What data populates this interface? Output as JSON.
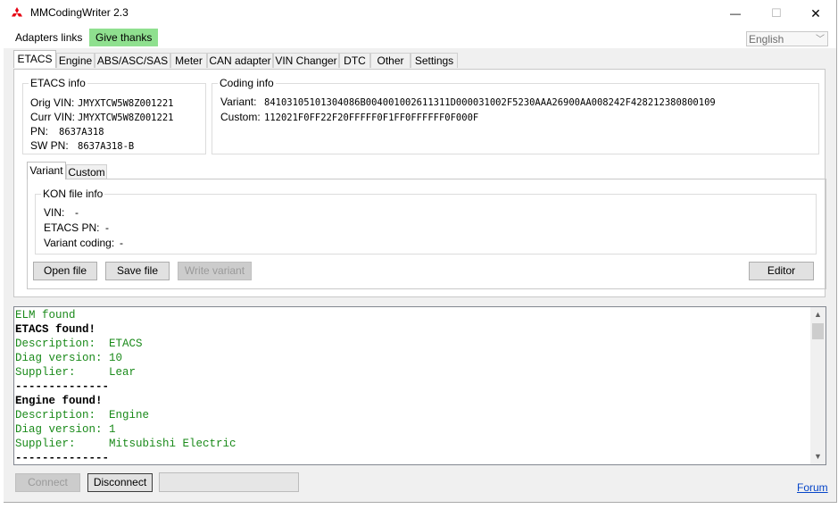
{
  "window": {
    "title": "MMCodingWriter 2.3",
    "minimize_symbol": "—",
    "maximize_symbol": "☐",
    "close_symbol": "✕"
  },
  "menu": {
    "adapters_links": "Adapters links",
    "give_thanks": "Give thanks"
  },
  "language": {
    "selected": "English"
  },
  "tabs": [
    "ETACS",
    "Engine",
    "ABS/ASC/SAS",
    "Meter",
    "CAN adapter",
    "VIN Changer",
    "DTC",
    "Other",
    "Settings"
  ],
  "etacs_info": {
    "title": "ETACS info",
    "orig_vin_label": "Orig VIN:",
    "orig_vin_value": "JMYXTCW5W8Z001221",
    "curr_vin_label": "Curr VIN:",
    "curr_vin_value": "JMYXTCW5W8Z001221",
    "pn_label": "PN:",
    "pn_value": "8637A318",
    "sw_pn_label": "SW PN:",
    "sw_pn_value": "8637A318-B"
  },
  "coding_info": {
    "title": "Coding info",
    "variant_label": "Variant:",
    "variant_value": "84103105101304086B004001002611311D000031002F5230AAA26900AA008242F428212380800109",
    "custom_label": "Custom:",
    "custom_value": "112021F0FF22F20FFFFF0F1FF0FFFFFF0F000F"
  },
  "subtabs": [
    "Variant",
    "Custom"
  ],
  "kon_info": {
    "title": "KON file info",
    "vin_label": "VIN:",
    "vin_value": "-",
    "etacs_pn_label": "ETACS PN:",
    "etacs_pn_value": "-",
    "variant_coding_label": "Variant coding:",
    "variant_coding_value": "-"
  },
  "buttons": {
    "open_file": "Open file",
    "save_file": "Save file",
    "write_variant": "Write variant",
    "editor": "Editor",
    "connect": "Connect",
    "disconnect": "Disconnect"
  },
  "log": [
    {
      "text": "ELM found",
      "color": "#1a8a1a",
      "bold": false
    },
    {
      "text": "ETACS found!",
      "color": "#000000",
      "bold": true
    },
    {
      "text": "Description:  ETACS",
      "color": "#1a8a1a",
      "bold": false
    },
    {
      "text": "Diag version: 10",
      "color": "#1a8a1a",
      "bold": false
    },
    {
      "text": "Supplier:     Lear",
      "color": "#1a8a1a",
      "bold": false
    },
    {
      "text": "--------------",
      "color": "#000000",
      "bold": true
    },
    {
      "text": "Engine found!",
      "color": "#000000",
      "bold": true
    },
    {
      "text": "Description:  Engine",
      "color": "#1a8a1a",
      "bold": false
    },
    {
      "text": "Diag version: 1",
      "color": "#1a8a1a",
      "bold": false
    },
    {
      "text": "Supplier:     Mitsubishi Electric",
      "color": "#1a8a1a",
      "bold": false
    },
    {
      "text": "--------------",
      "color": "#000000",
      "bold": true
    }
  ],
  "footer": {
    "forum_link": "Forum"
  },
  "colors": {
    "accent_green": "#8fe08f",
    "log_green": "#1a8a1a",
    "link_blue": "#0645c8",
    "logo_red": "#e60012"
  }
}
